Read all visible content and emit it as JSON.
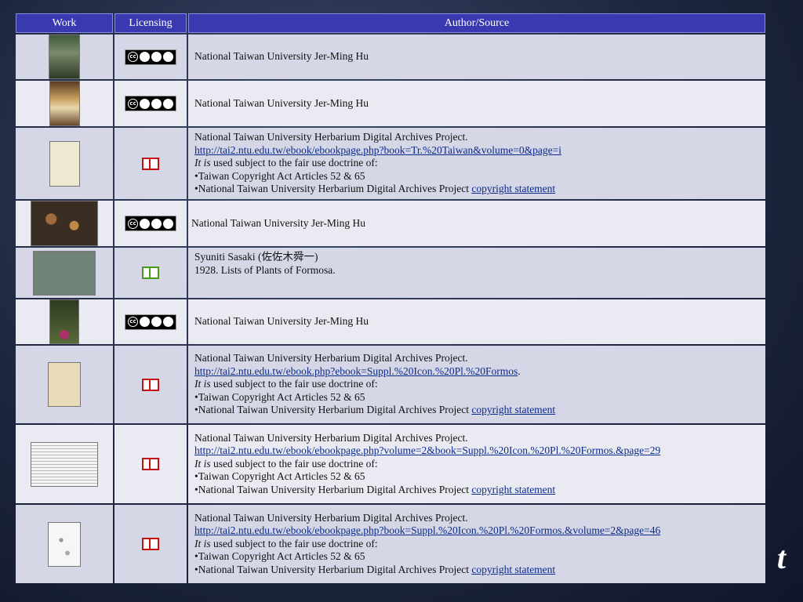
{
  "header": {
    "work": "Work",
    "licensing": "Licensing",
    "source": "Author/Source"
  },
  "rows": [
    {
      "license": "cc",
      "lines": [
        "National Taiwan University Jer-Ming Hu"
      ]
    },
    {
      "license": "cc",
      "lines": [
        "National Taiwan University Jer-Ming Hu"
      ]
    },
    {
      "license": "fairuse",
      "org": "National Taiwan University Herbarium Digital Archives Project.",
      "url": "http://tai2.ntu.edu.tw/ebook/ebookpage.php?book=Tr.%20Taiwan&volume=0&page=i",
      "it_is": "It is",
      "fair": " used subject to the fair use doctrine of:",
      "art": "•Taiwan Copyright Act Articles 52 & 65",
      "proj": "•National Taiwan University Herbarium Digital Archives Project ",
      "stmt": "copyright statement"
    },
    {
      "license": "cc",
      "lines": [
        "National Taiwan University Jer-Ming Hu"
      ]
    },
    {
      "license": "public",
      "lines": [
        "Syuniti Sasaki (佐佐木舜一)",
        "1928. Lists of Plants of Formosa."
      ]
    },
    {
      "license": "cc",
      "lines": [
        "National Taiwan University Jer-Ming Hu"
      ]
    },
    {
      "license": "fairuse",
      "org": "National Taiwan University Herbarium Digital Archives Project.",
      "url": "http://tai2.ntu.edu.tw/ebook.php?ebook=Suppl.%20Icon.%20Pl.%20Formos",
      "it_is": "It is",
      "fair": " used subject to the fair use doctrine of:",
      "art": "•Taiwan Copyright Act Articles 52 & 65",
      "proj": "•National Taiwan University Herbarium Digital Archives Project ",
      "stmt": "copyright statement"
    },
    {
      "license": "fairuse",
      "org": "National Taiwan University Herbarium Digital Archives Project.",
      "url": "http://tai2.ntu.edu.tw/ebook/ebookpage.php?volume=2&book=Suppl.%20Icon.%20Pl.%20Formos.&page=29",
      "it_is": "It is",
      "fair": " used subject to the fair use doctrine of:",
      "art": "•Taiwan Copyright Act Articles 52 & 65",
      "proj": "•National Taiwan University Herbarium Digital Archives Project ",
      "stmt": "copyright statement"
    },
    {
      "license": "fairuse",
      "org": "National Taiwan University Herbarium Digital Archives Project.",
      "url": "http://tai2.ntu.edu.tw/ebook/ebookpage.php?book=Suppl.%20Icon.%20Pl.%20Formos.&volume=2&page=46",
      "it_is": "It is",
      "fair": " used subject to the fair use doctrine of:",
      "art": "•Taiwan Copyright Act Articles 52 & 65",
      "proj": "•National Taiwan University Herbarium Digital Archives Project ",
      "stmt": "copyright statement"
    }
  ],
  "icons": {
    "cc": "cc-by-nc-sa-icon",
    "fairuse": "red-book-icon",
    "public": "green-book-icon"
  }
}
